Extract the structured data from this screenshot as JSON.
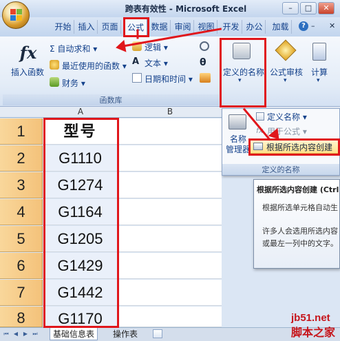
{
  "window": {
    "title": "跨表有效性 - Microsoft Excel",
    "buttons": [
      "–",
      "□",
      "✕"
    ]
  },
  "tabs": [
    "开始",
    "插入",
    "页面",
    "公式",
    "数据",
    "审阅",
    "视图",
    "开发",
    "办公",
    "加载"
  ],
  "active_tab": "公式",
  "help_label": "?",
  "ribbon": {
    "insert_function": {
      "label": "插入函数",
      "icon": "fx-icon",
      "glyph": "fx"
    },
    "autosum": "Σ 自动求和 ▾",
    "recent": "最近使用的函数 ▾",
    "finance": "财务 ▾",
    "logic": "逻辑 ▾",
    "text": "文本 ▾",
    "datetime": "日期和时间 ▾",
    "function_library_label": "函数库",
    "defined_names": "定义的名称",
    "formula_audit": "公式审核",
    "calculate": "计算"
  },
  "dropdown": {
    "name_manager": "名称\n管理器",
    "define_name": "定义名称 ▾",
    "use_in_formula": "用于公式 ▾",
    "create_from_selection": "根据所选内容创建",
    "footer": "定义的名称"
  },
  "tooltip": {
    "title": "根据所选内容创建 (Ctrl",
    "line1": "根据所选单元格自动生",
    "line2": "许多人会选用所选内容",
    "line3": "或最左一列中的文字。"
  },
  "column_header": "A",
  "column_header_b": "B",
  "rows": [
    {
      "num": "1",
      "value": "型号"
    },
    {
      "num": "2",
      "value": "G1110"
    },
    {
      "num": "3",
      "value": "G1274"
    },
    {
      "num": "4",
      "value": "G1164"
    },
    {
      "num": "5",
      "value": "G1205"
    },
    {
      "num": "6",
      "value": "G1429"
    },
    {
      "num": "7",
      "value": "G1442"
    },
    {
      "num": "8",
      "value": "G1170"
    }
  ],
  "sheets": [
    "基础信息表",
    "操作表"
  ],
  "nav": [
    "⏮",
    "◀",
    "▶",
    "⏭"
  ],
  "watermark": {
    "line1": "jb51.net",
    "line2": "脚本之家"
  },
  "colors": {
    "annotation": "#e0161b",
    "row_header": "#f4c27a",
    "ribbon": "#e3ecf7"
  }
}
